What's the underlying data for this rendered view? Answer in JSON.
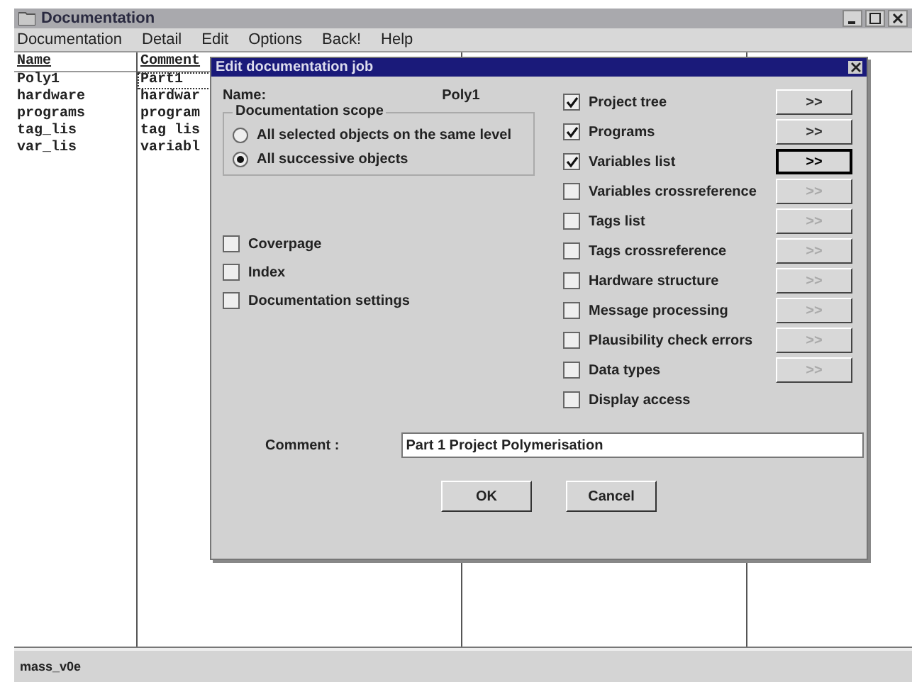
{
  "window": {
    "title": "Documentation"
  },
  "menu": [
    {
      "label": "Documentation"
    },
    {
      "label": "Detail"
    },
    {
      "label": "Edit"
    },
    {
      "label": "Options"
    },
    {
      "label": "Back!"
    },
    {
      "label": "Help"
    }
  ],
  "table": {
    "columns": [
      "Name",
      "Comment"
    ],
    "rows": [
      {
        "cells": [
          "Poly1",
          "Part1"
        ],
        "selected": true
      },
      {
        "cells": [
          "hardware",
          "hardwar"
        ],
        "selected": false
      },
      {
        "cells": [
          "programs",
          "program"
        ],
        "selected": false
      },
      {
        "cells": [
          "tag_lis",
          "tag lis"
        ],
        "selected": false
      },
      {
        "cells": [
          "var_lis",
          "variabl"
        ],
        "selected": false
      }
    ]
  },
  "dialog": {
    "title": "Edit documentation job",
    "name_label": "Name:",
    "name_value": "Poly1",
    "scope": {
      "title": "Documentation scope",
      "options": [
        {
          "label": "All selected objects on the same level",
          "selected": false
        },
        {
          "label": "All successive objects",
          "selected": true
        }
      ]
    },
    "left_options": [
      {
        "label": "Coverpage",
        "checked": false
      },
      {
        "label": "Index",
        "checked": false
      },
      {
        "label": "Documentation settings",
        "checked": false
      }
    ],
    "right_options": [
      {
        "label": "Project tree",
        "checked": true,
        "kind": "button",
        "button": ">>",
        "disabled": false,
        "focused": false
      },
      {
        "label": "Programs",
        "checked": true,
        "kind": "button",
        "button": ">>",
        "disabled": false,
        "focused": false
      },
      {
        "label": "Variables list",
        "checked": true,
        "kind": "button",
        "button": ">>",
        "disabled": false,
        "focused": true
      },
      {
        "label": "Variables crossreference",
        "checked": false,
        "kind": "button",
        "button": ">>",
        "disabled": true,
        "focused": false
      },
      {
        "label": "Tags list",
        "checked": false,
        "kind": "button",
        "button": ">>",
        "disabled": true,
        "focused": false
      },
      {
        "label": "Tags crossreference",
        "checked": false,
        "kind": "button",
        "button": ">>",
        "disabled": true,
        "focused": false
      },
      {
        "label": "Hardware structure",
        "checked": false,
        "kind": "button",
        "button": ">>",
        "disabled": true,
        "focused": false
      },
      {
        "label": "Message processing",
        "checked": false,
        "kind": "button",
        "button": ">>",
        "disabled": true,
        "focused": false
      },
      {
        "label": "Plausibility check errors",
        "checked": false,
        "kind": "button",
        "button": ">>",
        "disabled": true,
        "focused": false
      },
      {
        "label": "Data types",
        "checked": false,
        "kind": "button",
        "button": ">>",
        "disabled": true,
        "focused": false
      },
      {
        "label": "Display access",
        "checked": false,
        "kind": "plain"
      }
    ],
    "comment_label": "Comment :",
    "comment_value": "Part 1 Project Polymerisation",
    "buttons": [
      {
        "label": "OK"
      },
      {
        "label": "Cancel"
      }
    ]
  },
  "status_bar": "mass_v0e"
}
